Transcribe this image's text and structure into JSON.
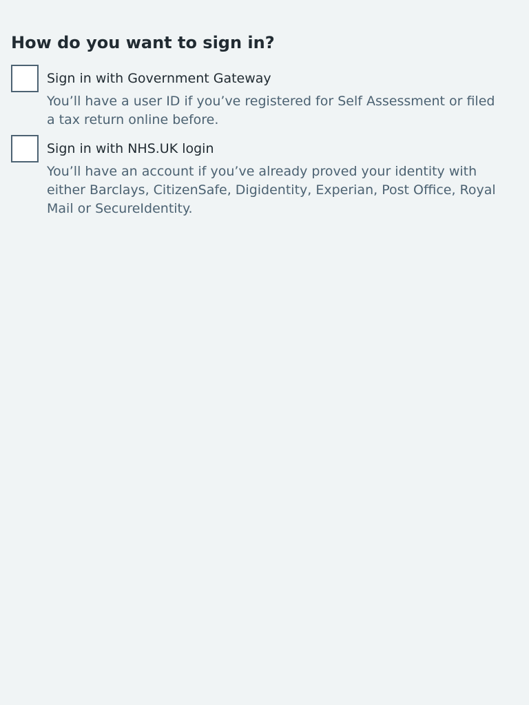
{
  "page": {
    "heading": "How do you want to sign in?"
  },
  "options": [
    {
      "label": "Sign in with Government Gateway",
      "hint": "You’ll have a user ID if you’ve registered for Self Assessment or filed a tax return online before.",
      "checked": false
    },
    {
      "label": "Sign in with NHS.UK login",
      "hint": "You’ll have an account if you’ve already proved your identity with either Barclays, CitizenSafe, Digidentity, Experian, Post Office, Royal Mail or SecureIdentity.",
      "checked": false
    }
  ],
  "colors": {
    "background": "#f0f4f5",
    "text": "#212b32",
    "hint": "#4c6272",
    "checkbox_border": "#4c6272"
  }
}
